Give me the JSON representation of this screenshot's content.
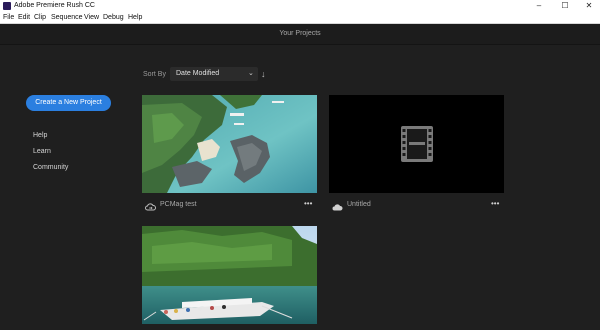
{
  "window": {
    "title": "Adobe Premiere Rush CC",
    "minimize": "–",
    "maximize": "☐",
    "close": "✕"
  },
  "menu": [
    "File",
    "Edit",
    "Clip",
    "Sequence",
    "View",
    "Debug",
    "Help"
  ],
  "header": {
    "title": "Your Projects"
  },
  "sidebar": {
    "create_label": "Create a New Project",
    "links": [
      "Help",
      "Learn",
      "Community"
    ]
  },
  "sort": {
    "label": "Sort By",
    "value": "Date Modified",
    "chevron": "⌄",
    "direction": "↓"
  },
  "projects": [
    {
      "name": "PCMag test",
      "status_icon": "cloud-sync-icon",
      "more": "•••"
    },
    {
      "name": "Untitled",
      "status_icon": "cloud-icon",
      "more": "•••"
    },
    {
      "name": "",
      "status_icon": "",
      "more": ""
    }
  ],
  "colors": {
    "accent": "#2b7fe0",
    "background": "#1f1f1f"
  }
}
